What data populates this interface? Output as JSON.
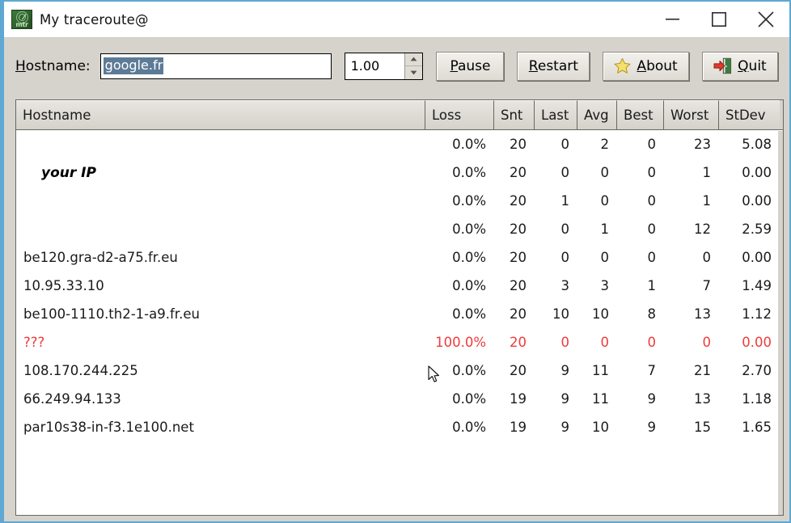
{
  "window": {
    "title": "My traceroute@",
    "icon": "mtr-radar-icon",
    "accent_border": "#5fa8d3",
    "controls": {
      "minimize": "minimize-icon",
      "maximize": "maximize-icon",
      "close": "close-icon"
    }
  },
  "toolbar": {
    "hostname_label_prefix": "H",
    "hostname_label_rest": "ostname:",
    "hostname_value": "google.fr",
    "hostname_placeholder": "",
    "hostname_selected": true,
    "interval_value": "1.00",
    "pause_accel": "P",
    "pause_rest": "ause",
    "restart_accel": "R",
    "restart_rest": "estart",
    "about_accel": "A",
    "about_rest": "bout",
    "about_icon": "star-icon",
    "quit_accel": "Q",
    "quit_rest": "uit",
    "quit_icon": "exit-door-icon"
  },
  "table": {
    "columns": [
      "Hostname",
      "Loss",
      "Snt",
      "Last",
      "Avg",
      "Best",
      "Worst",
      "StDev"
    ],
    "rows": [
      {
        "host": "",
        "annotation": "",
        "loss": "0.0%",
        "snt": "20",
        "last": "0",
        "avg": "2",
        "best": "0",
        "worst": "23",
        "stdev": "5.08",
        "failed": false
      },
      {
        "host": "",
        "annotation": "your IP",
        "loss": "0.0%",
        "snt": "20",
        "last": "0",
        "avg": "0",
        "best": "0",
        "worst": "1",
        "stdev": "0.00",
        "failed": false
      },
      {
        "host": "",
        "annotation": "",
        "loss": "0.0%",
        "snt": "20",
        "last": "1",
        "avg": "0",
        "best": "0",
        "worst": "1",
        "stdev": "0.00",
        "failed": false
      },
      {
        "host": "",
        "annotation": "",
        "loss": "0.0%",
        "snt": "20",
        "last": "0",
        "avg": "1",
        "best": "0",
        "worst": "12",
        "stdev": "2.59",
        "failed": false
      },
      {
        "host": "be120.gra-d2-a75.fr.eu",
        "annotation": "",
        "loss": "0.0%",
        "snt": "20",
        "last": "0",
        "avg": "0",
        "best": "0",
        "worst": "0",
        "stdev": "0.00",
        "failed": false
      },
      {
        "host": "10.95.33.10",
        "annotation": "",
        "loss": "0.0%",
        "snt": "20",
        "last": "3",
        "avg": "3",
        "best": "1",
        "worst": "7",
        "stdev": "1.49",
        "failed": false
      },
      {
        "host": "be100-1110.th2-1-a9.fr.eu",
        "annotation": "",
        "loss": "0.0%",
        "snt": "20",
        "last": "10",
        "avg": "10",
        "best": "8",
        "worst": "13",
        "stdev": "1.12",
        "failed": false
      },
      {
        "host": "???",
        "annotation": "",
        "loss": "100.0%",
        "snt": "20",
        "last": "0",
        "avg": "0",
        "best": "0",
        "worst": "0",
        "stdev": "0.00",
        "failed": true
      },
      {
        "host": "108.170.244.225",
        "annotation": "",
        "loss": "0.0%",
        "snt": "20",
        "last": "9",
        "avg": "11",
        "best": "7",
        "worst": "21",
        "stdev": "2.70",
        "failed": false
      },
      {
        "host": "66.249.94.133",
        "annotation": "",
        "loss": "0.0%",
        "snt": "19",
        "last": "9",
        "avg": "11",
        "best": "9",
        "worst": "13",
        "stdev": "1.18",
        "failed": false
      },
      {
        "host": "par10s38-in-f3.1e100.net",
        "annotation": "",
        "loss": "0.0%",
        "snt": "19",
        "last": "9",
        "avg": "10",
        "best": "9",
        "worst": "15",
        "stdev": "1.65",
        "failed": false
      }
    ],
    "failed_color": "#ee3b3b",
    "text_color": "#1a1a1a"
  }
}
